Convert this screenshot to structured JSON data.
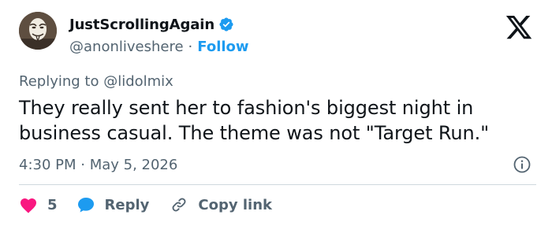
{
  "author": {
    "display_name": "JustScrollingAgain",
    "handle": "@anonliveshere",
    "separator": "·",
    "follow_label": "Follow",
    "verified": true
  },
  "reply_context": "Replying to @lidolmix",
  "tweet": {
    "text": "They really sent her to fashion's biggest night in business casual. The theme was not \"Target Run.\""
  },
  "meta": {
    "timestamp": "4:30 PM · May 5, 2026"
  },
  "actions": {
    "like_count": "5",
    "reply_label": "Reply",
    "copy_link_label": "Copy link"
  },
  "colors": {
    "accent": "#1d9bf0",
    "like": "#f91880",
    "secondary_text": "#536471",
    "primary_text": "#0f1419"
  },
  "icons": [
    "verified-badge-icon",
    "x-logo-icon",
    "info-icon",
    "heart-icon",
    "reply-bubble-icon",
    "link-icon"
  ]
}
